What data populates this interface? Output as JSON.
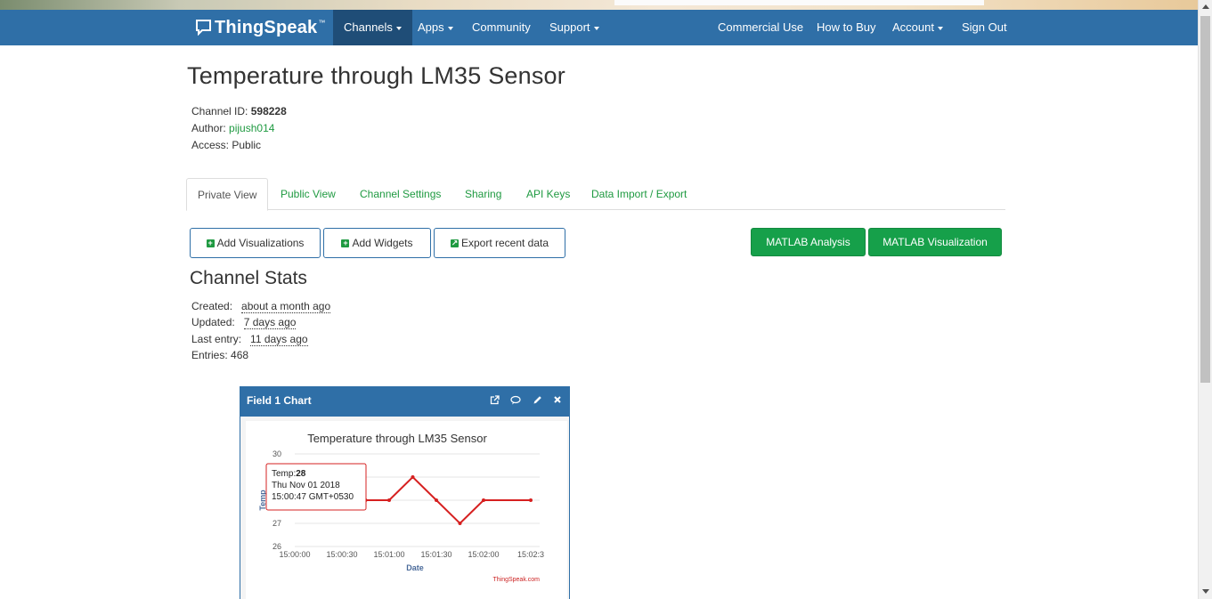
{
  "navbar": {
    "brand": "ThingSpeak",
    "brand_tm": "™",
    "items": [
      {
        "label": "Channels",
        "dropdown": true,
        "active": true
      },
      {
        "label": "Apps",
        "dropdown": true
      },
      {
        "label": "Community",
        "dropdown": false
      },
      {
        "label": "Support",
        "dropdown": true
      },
      {
        "label": "Commercial Use",
        "dropdown": false
      },
      {
        "label": "How to Buy",
        "dropdown": false
      },
      {
        "label": "Account",
        "dropdown": true
      },
      {
        "label": "Sign Out",
        "dropdown": false
      }
    ]
  },
  "channel": {
    "title": "Temperature through LM35 Sensor",
    "id_label": "Channel ID:",
    "id_value": "598228",
    "author_label": "Author:",
    "author_value": "pijush014",
    "access_label": "Access:",
    "access_value": "Public"
  },
  "tabs": [
    "Private View",
    "Public View",
    "Channel Settings",
    "Sharing",
    "API Keys",
    "Data Import / Export"
  ],
  "buttons": {
    "add_visualizations": "Add Visualizations",
    "add_widgets": "Add Widgets",
    "export_recent": "Export recent data",
    "matlab_analysis": "MATLAB Analysis",
    "matlab_visualization": "MATLAB Visualization"
  },
  "stats": {
    "title": "Channel Stats",
    "created_label": "Created:",
    "created_value": "about a month ago",
    "updated_label": "Updated:",
    "updated_value": "7 days ago",
    "last_entry_label": "Last entry:",
    "last_entry_value": "11 days ago",
    "entries_label": "Entries:",
    "entries_value": "468"
  },
  "widget": {
    "title": "Field 1 Chart",
    "icons": [
      "external-link-icon",
      "comment-icon",
      "pencil-icon",
      "close-icon"
    ]
  },
  "colors": {
    "navbar": "#2f6fa7",
    "accent_green": "#1f9a41",
    "button_green": "#16a04a",
    "series": "#d62020"
  },
  "chart_data": {
    "type": "line",
    "title": "Temperature through LM35 Sensor",
    "xlabel": "Date",
    "ylabel": "Temp",
    "ylim": [
      26,
      30
    ],
    "yticks": [
      "30",
      "27",
      "26"
    ],
    "xticks": [
      "15:00:00",
      "15:00:30",
      "15:01:00",
      "15:01:30",
      "15:02:00",
      "15:02:3"
    ],
    "x": [
      "15:00:00",
      "15:00:15",
      "15:00:30",
      "15:00:45",
      "15:01:00",
      "15:01:15",
      "15:01:30",
      "15:01:45",
      "15:02:00",
      "15:02:30"
    ],
    "values": [
      28,
      28,
      28,
      28,
      28,
      29,
      28,
      27,
      28,
      28
    ],
    "credit": "ThingSpeak.com",
    "tooltip": {
      "series_label": "Temp:",
      "value": "28",
      "date": "Thu Nov 01 2018",
      "time": "15:00:47 GMT+0530"
    },
    "grid": true,
    "legend": "none"
  }
}
